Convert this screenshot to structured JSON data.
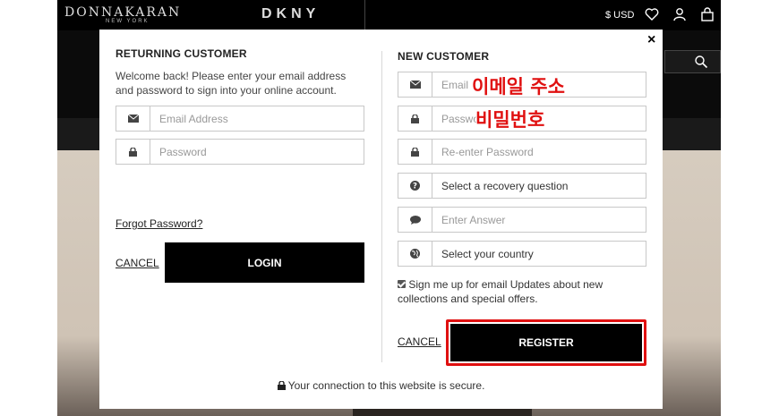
{
  "header": {
    "brand_main": "DONNAKARAN",
    "brand_sub": "NEW YORK",
    "brand_dkny": "DKNY",
    "currency": "$ USD",
    "icons": [
      "heart-icon",
      "user-icon",
      "bag-icon",
      "search-icon"
    ]
  },
  "modal": {
    "close_label": "×",
    "returning": {
      "heading": "RETURNING CUSTOMER",
      "intro": "Welcome back! Please enter your email address and password to sign into your online account.",
      "email_placeholder": "Email Address",
      "password_placeholder": "Password",
      "forgot_label": "Forgot Password?",
      "cancel_label": "CANCEL",
      "login_label": "LOGIN"
    },
    "new_customer": {
      "heading": "NEW CUSTOMER",
      "email_placeholder": "Email",
      "password_placeholder": "Passwo",
      "reenter_placeholder": "Re-enter Password",
      "recovery_value": "Select a recovery question",
      "answer_placeholder": "Enter Answer",
      "country_value": "Select your country",
      "signup_text": "Sign me up for email Updates about new collections and special offers.",
      "signup_checked": true,
      "cancel_label": "CANCEL",
      "register_label": "REGISTER"
    },
    "secure_text": "Your connection to this website is secure."
  },
  "annotations": {
    "email_korean": "이메일 주소",
    "password_korean": "비밀번호",
    "highlight_color": "#e01010"
  }
}
